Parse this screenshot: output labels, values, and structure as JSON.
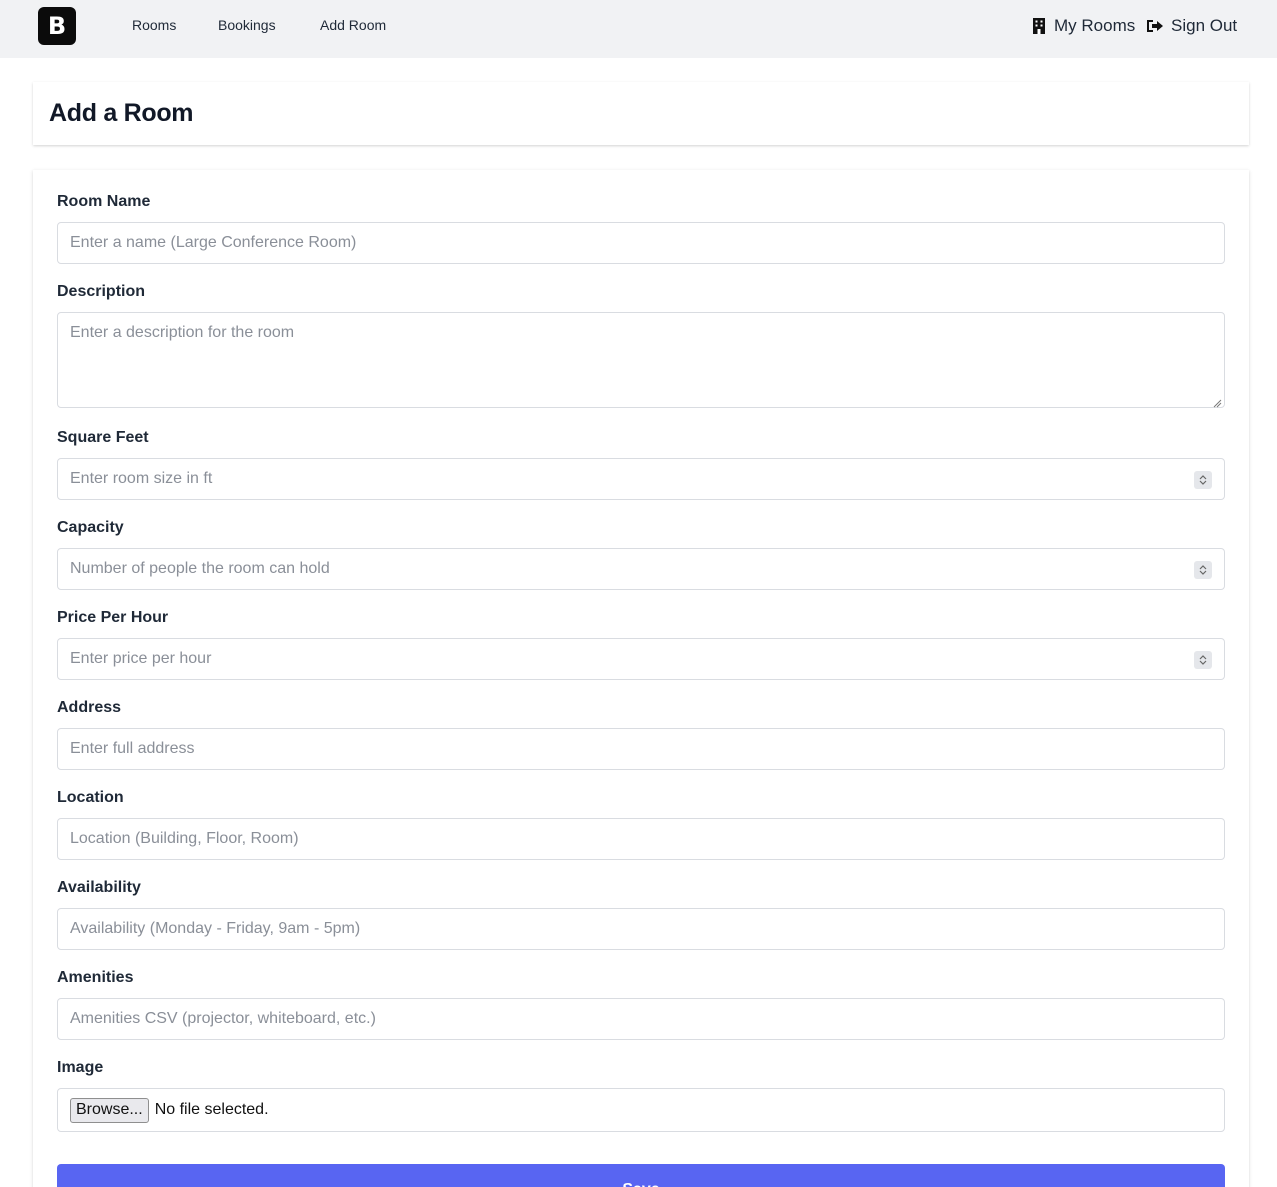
{
  "nav": {
    "logo": "B",
    "links": [
      "Rooms",
      "Bookings",
      "Add Room"
    ],
    "my_rooms": "My Rooms",
    "sign_out": "Sign Out"
  },
  "page": {
    "title": "Add a Room"
  },
  "form": {
    "room_name": {
      "label": "Room Name",
      "placeholder": "Enter a name (Large Conference Room)"
    },
    "description": {
      "label": "Description",
      "placeholder": "Enter a description for the room"
    },
    "square_feet": {
      "label": "Square Feet",
      "placeholder": "Enter room size in ft"
    },
    "capacity": {
      "label": "Capacity",
      "placeholder": "Number of people the room can hold"
    },
    "price_per_hour": {
      "label": "Price Per Hour",
      "placeholder": "Enter price per hour"
    },
    "address": {
      "label": "Address",
      "placeholder": "Enter full address"
    },
    "location": {
      "label": "Location",
      "placeholder": "Location (Building, Floor, Room)"
    },
    "availability": {
      "label": "Availability",
      "placeholder": "Availability (Monday - Friday, 9am - 5pm)"
    },
    "amenities": {
      "label": "Amenities",
      "placeholder": "Amenities CSV (projector, whiteboard, etc.)"
    },
    "image": {
      "label": "Image",
      "browse_label": "Browse...",
      "status": "No file selected."
    },
    "save_label": "Save"
  },
  "colors": {
    "accent": "#5865f2",
    "nav_bg": "#f1f2f4",
    "logo_bg": "#0b0b0b"
  }
}
